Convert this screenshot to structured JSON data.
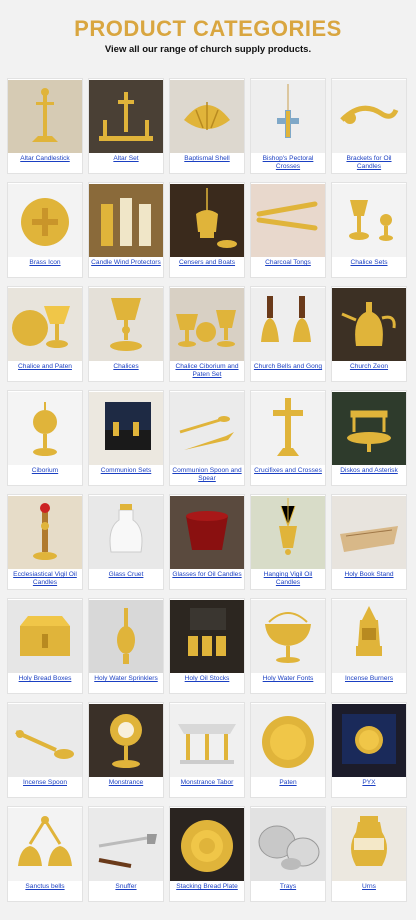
{
  "header": {
    "title": "PRODUCT CATEGORIES",
    "subtitle": "View all our range of church supply products."
  },
  "colors": {
    "title": "#d9a640",
    "link": "#1a3fc2",
    "gold": "#e0b43a"
  },
  "categories": [
    {
      "label": "Altar Candlestick",
      "icon": "candlestick-icon",
      "bg": "#d6cbb4"
    },
    {
      "label": "Altar Set",
      "icon": "cross-candles-icon",
      "bg": "#4a4035"
    },
    {
      "label": "Baptismal Shell",
      "icon": "shell-icon",
      "bg": "#ddd8cf"
    },
    {
      "label": "Bishop's Pectoral Crosses",
      "icon": "pectoral-cross-icon",
      "bg": "#eeeeee"
    },
    {
      "label": "Brackets for Oil Candles",
      "icon": "bracket-icon",
      "bg": "#f0f0f0"
    },
    {
      "label": "Brass Icon",
      "icon": "plate-icon",
      "bg": "#f3f3f3"
    },
    {
      "label": "Candle Wind Protectors",
      "icon": "candle-protector-icon",
      "bg": "#8a6a3a"
    },
    {
      "label": "Censers and Boats",
      "icon": "censer-icon",
      "bg": "#3a2a1c"
    },
    {
      "label": "Charcoal Tongs",
      "icon": "tongs-icon",
      "bg": "#e8d8cc"
    },
    {
      "label": "Chalice Sets",
      "icon": "chalice-set-icon",
      "bg": "#f3f3f3"
    },
    {
      "label": "Chalice and Paten",
      "icon": "chalice-paten-icon",
      "bg": "#e8e4dc"
    },
    {
      "label": "Chalices",
      "icon": "chalice-icon",
      "bg": "#e4e0d8"
    },
    {
      "label": "Chalice Ciborium and Paten Set",
      "icon": "ciborium-set-icon",
      "bg": "#d8d0c4"
    },
    {
      "label": "Church Bells and Gong",
      "icon": "bells-icon",
      "bg": "#eeeeee"
    },
    {
      "label": "Church Zeon",
      "icon": "zeon-icon",
      "bg": "#3c3024"
    },
    {
      "label": "Ciborium",
      "icon": "ciborium-icon",
      "bg": "#f4f4f4"
    },
    {
      "label": "Communion Sets",
      "icon": "communion-set-icon",
      "bg": "#ece8e0"
    },
    {
      "label": "Communion Spoon and Spear",
      "icon": "spoon-spear-icon",
      "bg": "#ebebeb"
    },
    {
      "label": "Crucifixes and Crosses",
      "icon": "crucifix-icon",
      "bg": "#f2f2f2"
    },
    {
      "label": "Diskos and Asterisk",
      "icon": "diskos-icon",
      "bg": "#2e3b2c"
    },
    {
      "label": "Ecclesiastical Vigil Oil Candles",
      "icon": "vigil-candle-icon",
      "bg": "#e6dcc8"
    },
    {
      "label": "Glass Cruet",
      "icon": "cruet-icon",
      "bg": "#e8e8e8"
    },
    {
      "label": "Glasses for Oil Candles",
      "icon": "red-glass-icon",
      "bg": "#5a4a3e"
    },
    {
      "label": "Hanging Vigil Oil Candles",
      "icon": "hanging-candle-icon",
      "bg": "#d8dcc8"
    },
    {
      "label": "Holy Book Stand",
      "icon": "book-stand-icon",
      "bg": "#e8e4de"
    },
    {
      "label": "Holy Bread Boxes",
      "icon": "bread-box-icon",
      "bg": "#e6e6e6"
    },
    {
      "label": "Holy Water Sprinklers",
      "icon": "sprinkler-icon",
      "bg": "#d8d8d8"
    },
    {
      "label": "Holy Oil Stocks",
      "icon": "oil-stocks-icon",
      "bg": "#2c2620"
    },
    {
      "label": "Holy Water Fonts",
      "icon": "water-font-icon",
      "bg": "#eeeeee"
    },
    {
      "label": "Incense Burners",
      "icon": "incense-burner-icon",
      "bg": "#f0f0f0"
    },
    {
      "label": "Incense Spoon",
      "icon": "incense-spoon-icon",
      "bg": "#eaeaea"
    },
    {
      "label": "Monstrance",
      "icon": "monstrance-icon",
      "bg": "#3a3028"
    },
    {
      "label": "Monstrance Tabor",
      "icon": "tabor-icon",
      "bg": "#f0f0f0"
    },
    {
      "label": "Paten",
      "icon": "paten-icon",
      "bg": "#efefef"
    },
    {
      "label": "PYX",
      "icon": "pyx-icon",
      "bg": "#1c1c2a"
    },
    {
      "label": "Sanctus bells",
      "icon": "sanctus-bells-icon",
      "bg": "#f3f3f3"
    },
    {
      "label": "Snuffer",
      "icon": "snuffer-icon",
      "bg": "#eaeaea"
    },
    {
      "label": "Stacking Bread Plate",
      "icon": "bread-plate-icon",
      "bg": "#2a2420"
    },
    {
      "label": "Trays",
      "icon": "trays-icon",
      "bg": "#e2e2e2"
    },
    {
      "label": "Urns",
      "icon": "urn-icon",
      "bg": "#ece8e0"
    }
  ]
}
